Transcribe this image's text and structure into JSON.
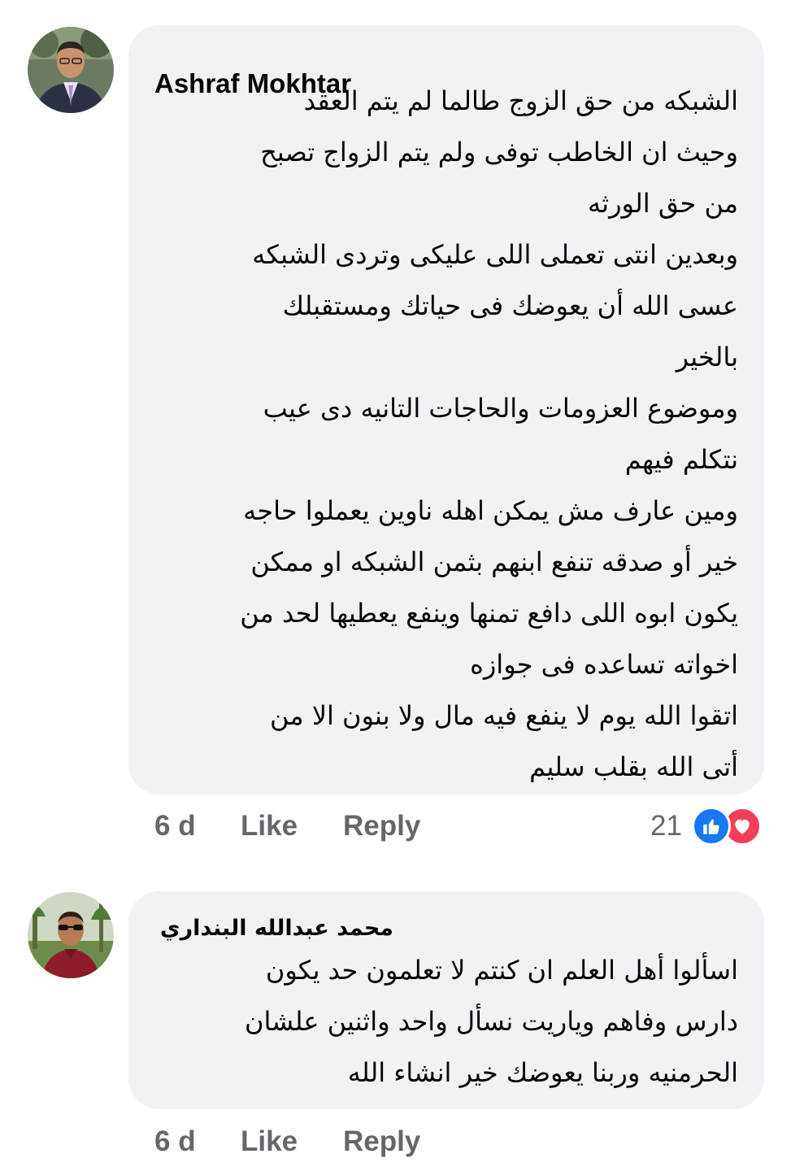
{
  "comments": [
    {
      "author": "Ashraf Mokhtar",
      "avatar_icon": "user-avatar-photo",
      "lines": [
        "الشبكه من حق الزوج طالما لم يتم العقد",
        "وحيث ان الخاطب توفى ولم يتم الزواج تصبح",
        "من حق الورثه",
        "وبعدين انتى تعملى اللى عليكى وتردى الشبكه",
        "عسى الله أن يعوضك فى حياتك ومستقبلك",
        "بالخير",
        "وموضوع العزومات والحاجات التانيه دى عيب",
        "نتكلم فيهم",
        "ومين عارف مش يمكن اهله ناوين يعملوا حاجه",
        "خير أو صدقه تنفع ابنهم بثمن الشبكه او ممكن",
        "يكون ابوه اللى دافع تمنها وينفع يعطيها لحد من",
        "اخواته تساعده فى جوازه",
        "اتقوا الله يوم لا ينفع فيه مال ولا بنون الا من",
        "أتى الله بقلب سليم"
      ],
      "time": "6 d",
      "like_label": "Like",
      "reply_label": "Reply",
      "reaction_count": "21",
      "reaction_icons": [
        "like-reaction-icon",
        "love-reaction-icon"
      ]
    },
    {
      "author": "محمد عبدالله البنداري",
      "avatar_icon": "user-avatar-photo",
      "lines": [
        "اسألوا أهل العلم ان كنتم لا تعلمون حد يكون",
        "دارس وفاهم وياريت نسأل واحد واثنين علشان",
        "الحرمنيه وربنا يعوضك خير انشاء الله"
      ],
      "time": "6 d",
      "like_label": "Like",
      "reply_label": "Reply"
    }
  ],
  "colors": {
    "bubble_bg": "#f0f2f5",
    "text": "#050505",
    "secondary_text": "#65676b",
    "like_blue": "#1877f2",
    "love_red": "#f33e58"
  }
}
